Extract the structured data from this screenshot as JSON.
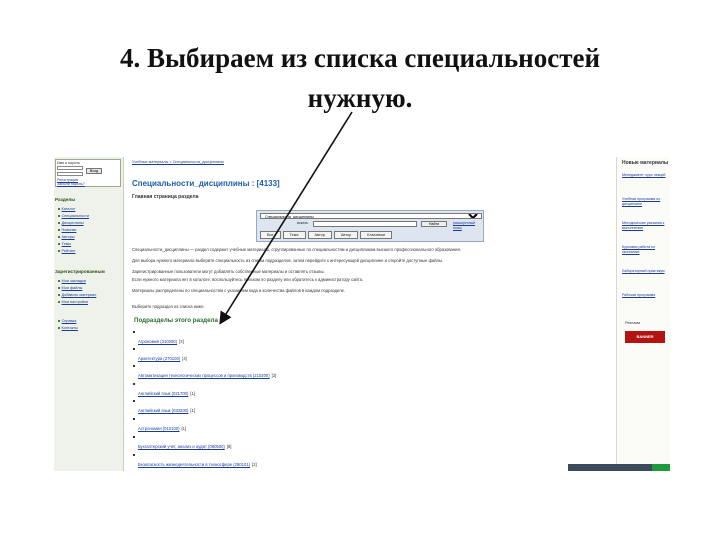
{
  "slide": {
    "title_line1": "4. Выбираем из списка специальностей",
    "title_line2": "нужную."
  },
  "sidebar": {
    "login_label": "Имя и пароль",
    "login_button": "Вход",
    "register_link": "Регистрация",
    "forgot_link": "Забыли пароль?",
    "section_label": "Разделы",
    "items": [
      "Каталог",
      "Специальности",
      "Дисциплины",
      "Новинки",
      "Авторы",
      "Темы",
      "Рейтинг"
    ],
    "reg_label": "Зарегистрированным",
    "reg_items": [
      "Мои закладки",
      "Мои файлы",
      "Добавить материал",
      "Мои настройки"
    ],
    "extra_items": [
      "Справка",
      "Контакты"
    ]
  },
  "main": {
    "breadcrumb": "Учебные материалы > Специальности_дисциплины",
    "section_title": "Специальности_дисциплины : [4133]",
    "section_subtitle": "Главная страница раздела",
    "search": {
      "select_value": "Специальности_дисциплины",
      "query_label": "искать",
      "find_button": "Найти",
      "advanced_link": "расширенный поиск",
      "tabs": [
        "Все",
        "Тема",
        "Автор",
        "Автор",
        "Ключевые"
      ]
    },
    "paragraphs": [
      "Специальности_дисциплины — раздел содержит учебные материалы, сгруппированные по специальностям и дисциплинам высшего профессионального образования.",
      "Для выбора нужного материала выберите специальность из списка подразделов, затем перейдите к интересующей дисциплине и откройте доступные файлы.",
      "Зарегистрированные пользователи могут добавлять собственные материалы и оставлять отзывы.",
      "Если нужного материала нет в каталоге, воспользуйтесь поиском по разделу или обратитесь к администратору сайта.",
      "Материалы распределены по специальностям с указанием кода и количества файлов в каждом подразделе.",
      "Выберите подраздел из списка ниже."
    ],
    "subsections_title": "Подразделы этого раздела",
    "subsections": [
      {
        "name": "Агрономия (310200)",
        "count": "[3]"
      },
      {
        "name": "Архитектура (270100)",
        "count": "[4]"
      },
      {
        "name": "Автоматизация технологических процессов и производств (210200)",
        "count": "[2]"
      },
      {
        "name": "Английский язык (021700)",
        "count": "[1]"
      },
      {
        "name": "Английский язык (033200)",
        "count": "[1]"
      },
      {
        "name": "Астрономия (010100)",
        "count": "[1]"
      },
      {
        "name": "Бухгалтерский учет, анализ и аудит (060500)",
        "count": "[8]"
      },
      {
        "name": "Безопасность жизнедеятельности в техносфере (280101)",
        "count": "[2]"
      }
    ]
  },
  "right": {
    "title": "Новые материалы",
    "links": [
      "Менеджмент: курс лекций",
      "Учебная программа по дисциплине",
      "Методические указания к выполнению",
      "Курсовая работа по экономике",
      "Лабораторный практикум",
      "Рабочая программа"
    ],
    "label": "Реклама",
    "banner": "BANNER"
  }
}
